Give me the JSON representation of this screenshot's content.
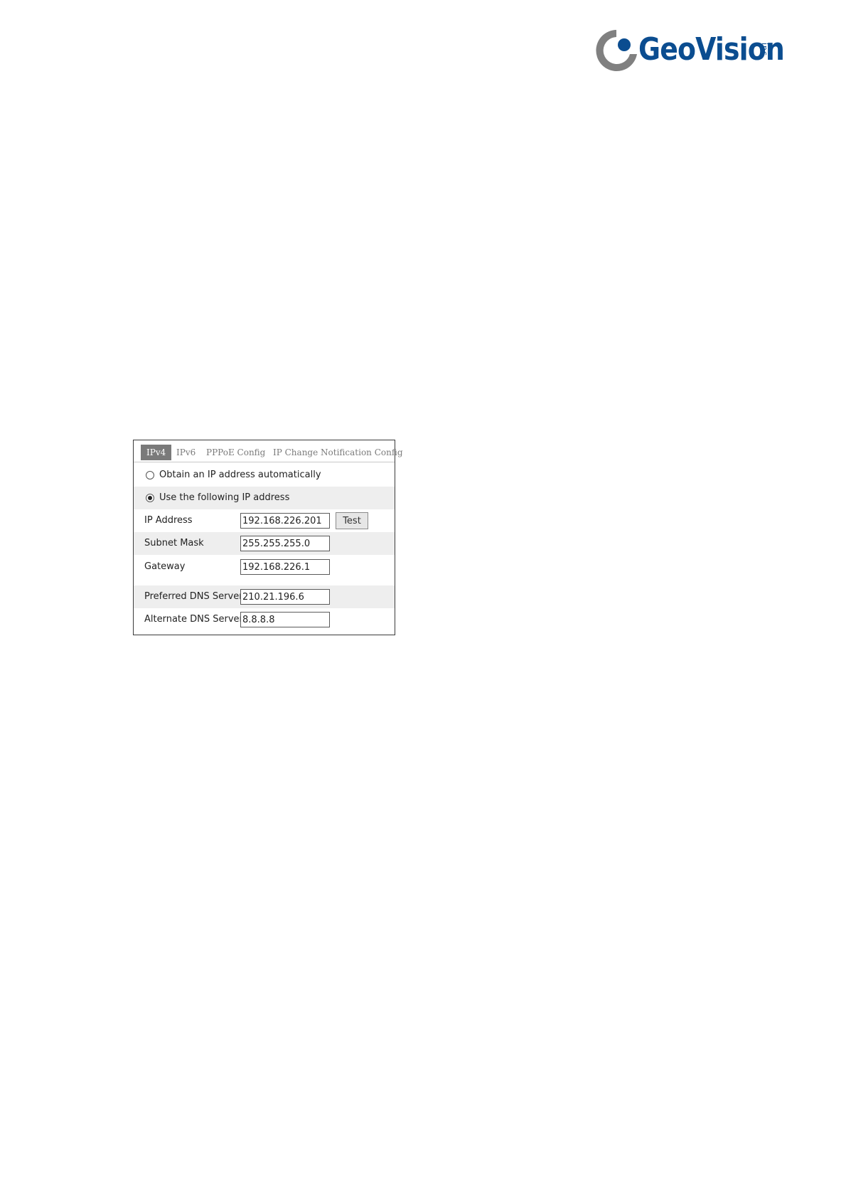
{
  "logo": {
    "brand": "GeoVision",
    "suffix": "inc",
    "colors": {
      "brand_blue": "#0b4d90",
      "mark_gray": "#808080"
    }
  },
  "tabs": [
    {
      "label": "IPv4",
      "active": true
    },
    {
      "label": "IPv6",
      "active": false
    },
    {
      "label": "PPPoE Config",
      "active": false
    },
    {
      "label": "IP Change Notification Config",
      "active": false
    }
  ],
  "ip_mode": {
    "options": [
      {
        "label": "Obtain an IP address automatically",
        "selected": false
      },
      {
        "label": "Use the following IP address",
        "selected": true
      }
    ]
  },
  "fields": {
    "ip_address": {
      "label": "IP Address",
      "value": "192.168.226.201"
    },
    "subnet_mask": {
      "label": "Subnet Mask",
      "value": "255.255.255.0"
    },
    "gateway": {
      "label": "Gateway",
      "value": "192.168.226.1"
    },
    "preferred_dns": {
      "label": "Preferred DNS Server",
      "value": "210.21.196.6"
    },
    "alternate_dns": {
      "label": "Alternate DNS Server",
      "value": "8.8.8.8"
    }
  },
  "buttons": {
    "test_label": "Test"
  },
  "colors": {
    "active_tab_bg": "#7a7a7a",
    "inactive_tab_text": "#7b7b7b",
    "shaded_row": "#eeeeee"
  }
}
